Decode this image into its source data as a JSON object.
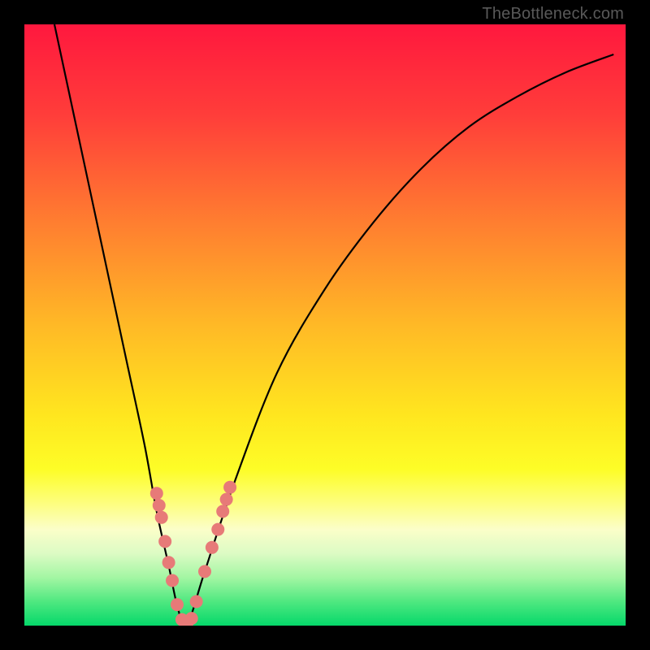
{
  "watermark": "TheBottleneck.com",
  "colors": {
    "frame": "#000000",
    "curve_stroke": "#000000",
    "dot_fill": "#e77a78",
    "gradient_stops": [
      {
        "offset": 0.0,
        "color": "#ff183e"
      },
      {
        "offset": 0.15,
        "color": "#ff3d3a"
      },
      {
        "offset": 0.33,
        "color": "#ff7e30"
      },
      {
        "offset": 0.5,
        "color": "#ffb926"
      },
      {
        "offset": 0.65,
        "color": "#ffe61f"
      },
      {
        "offset": 0.74,
        "color": "#fdfd27"
      },
      {
        "offset": 0.8,
        "color": "#fdfe84"
      },
      {
        "offset": 0.84,
        "color": "#fbfec9"
      },
      {
        "offset": 0.88,
        "color": "#dcfbc4"
      },
      {
        "offset": 0.92,
        "color": "#a3f6a3"
      },
      {
        "offset": 0.96,
        "color": "#4fe880"
      },
      {
        "offset": 1.0,
        "color": "#05d86a"
      }
    ]
  },
  "chart_data": {
    "type": "line",
    "title": "",
    "xlabel": "",
    "ylabel": "",
    "xlim": [
      0,
      100
    ],
    "ylim": [
      0,
      100
    ],
    "series": [
      {
        "name": "bottleneck-curve",
        "x": [
          5,
          8,
          11,
          14,
          17,
          20,
          22,
          24,
          25.5,
          27,
          30,
          35,
          42,
          50,
          58,
          66,
          74,
          82,
          90,
          98
        ],
        "values": [
          100,
          86,
          72,
          58,
          44,
          30,
          19,
          10,
          3,
          0,
          9,
          24,
          42,
          56,
          67,
          76,
          83,
          88,
          92,
          95
        ]
      }
    ],
    "dots": {
      "name": "highlight-dots",
      "points": [
        {
          "x": 22.0,
          "y": 22.0
        },
        {
          "x": 22.4,
          "y": 20.0
        },
        {
          "x": 22.8,
          "y": 18.0
        },
        {
          "x": 23.4,
          "y": 14.0
        },
        {
          "x": 24.0,
          "y": 10.5
        },
        {
          "x": 24.6,
          "y": 7.5
        },
        {
          "x": 25.4,
          "y": 3.5
        },
        {
          "x": 26.2,
          "y": 1.0
        },
        {
          "x": 27.0,
          "y": 0.0
        },
        {
          "x": 27.8,
          "y": 1.2
        },
        {
          "x": 28.6,
          "y": 4.0
        },
        {
          "x": 30.0,
          "y": 9.0
        },
        {
          "x": 31.2,
          "y": 13.0
        },
        {
          "x": 32.2,
          "y": 16.0
        },
        {
          "x": 33.0,
          "y": 19.0
        },
        {
          "x": 33.6,
          "y": 21.0
        },
        {
          "x": 34.2,
          "y": 23.0
        }
      ]
    }
  }
}
